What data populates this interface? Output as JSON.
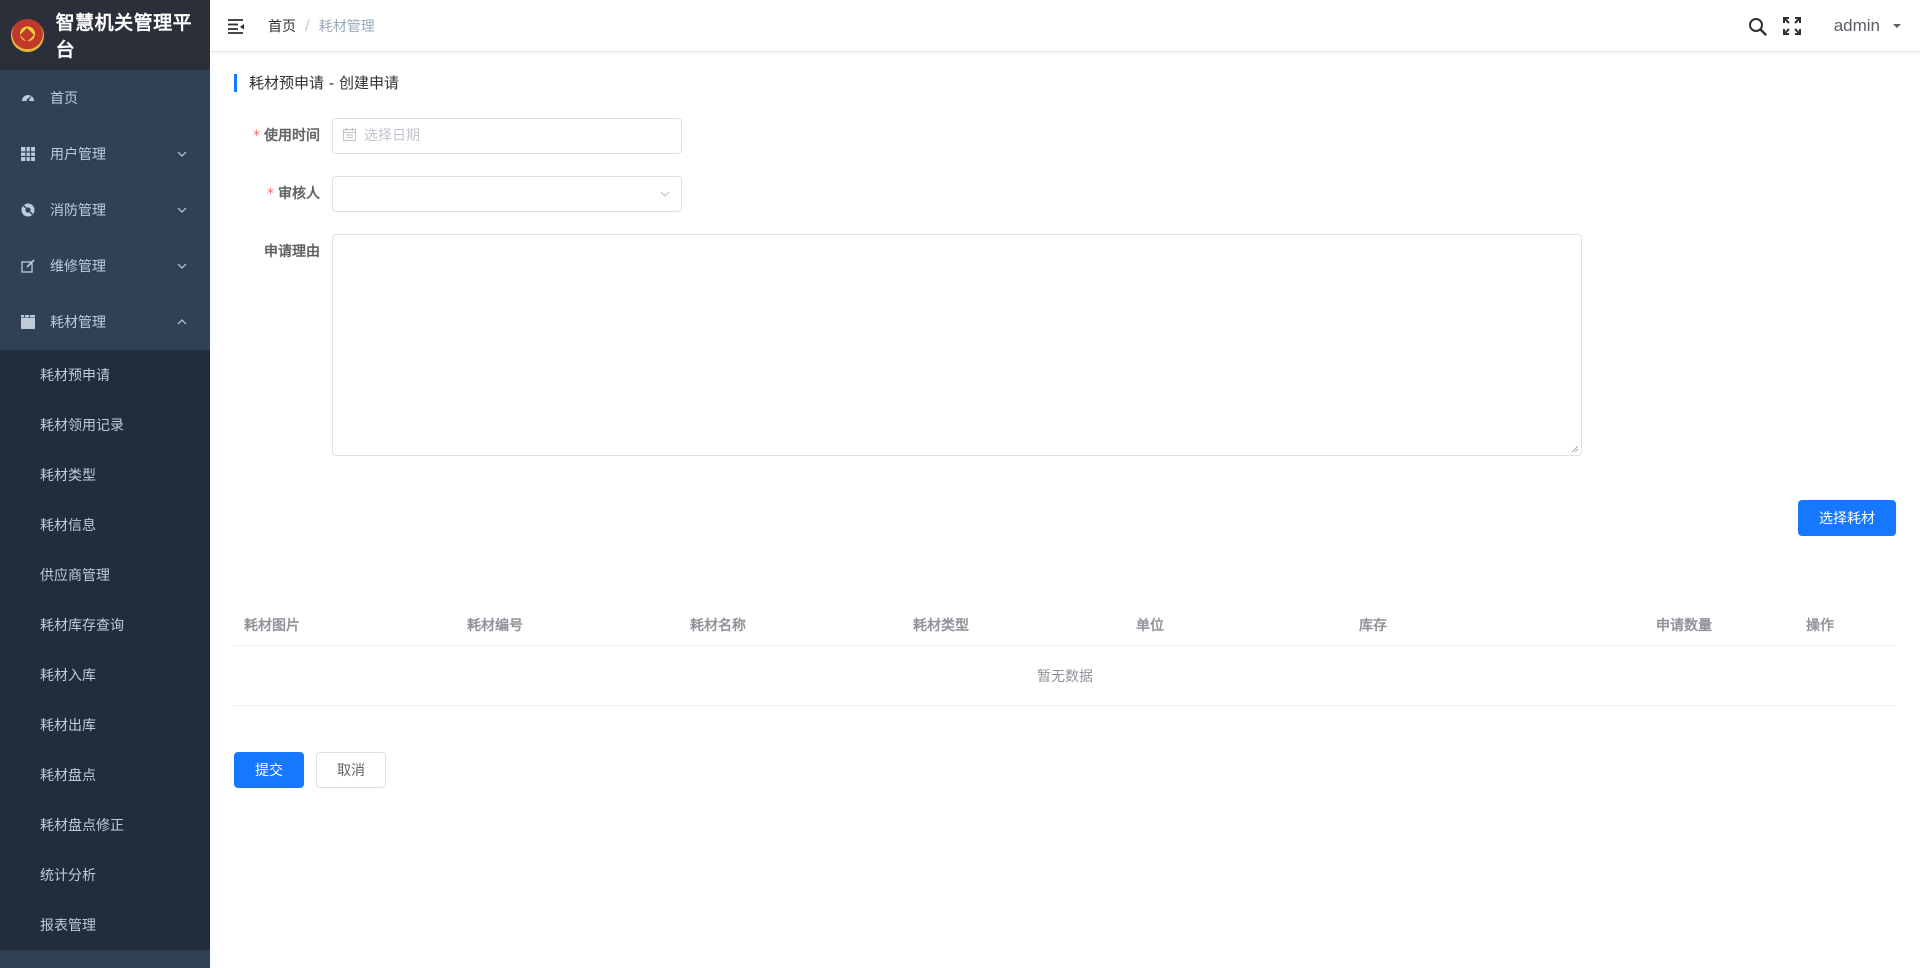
{
  "app": {
    "title": "智慧机关管理平台"
  },
  "sidebar": {
    "items": [
      {
        "label": "首页",
        "icon": "dashboard-icon",
        "expandable": false
      },
      {
        "label": "用户管理",
        "icon": "grid-icon",
        "expandable": true
      },
      {
        "label": "消防管理",
        "icon": "lifebuoy-icon",
        "expandable": true
      },
      {
        "label": "维修管理",
        "icon": "edit-icon",
        "expandable": true
      },
      {
        "label": "耗材管理",
        "icon": "clapper-icon",
        "expandable": true,
        "expanded": true
      }
    ],
    "subitems": [
      "耗材预申请",
      "耗材领用记录",
      "耗材类型",
      "耗材信息",
      "供应商管理",
      "耗材库存查询",
      "耗材入库",
      "耗材出库",
      "耗材盘点",
      "耗材盘点修正",
      "统计分析",
      "报表管理"
    ]
  },
  "header": {
    "breadcrumb": {
      "home": "首页",
      "separator": "/",
      "current": "耗材管理"
    },
    "user": "admin",
    "icons": [
      "menu-fold-icon",
      "search-icon",
      "fullscreen-icon",
      "caret-down-icon"
    ]
  },
  "page": {
    "title": "耗材预申请 - 创建申请",
    "form": {
      "use_time": {
        "label": "使用时间",
        "placeholder": "选择日期",
        "value": ""
      },
      "reviewer": {
        "label": "审核人",
        "value": ""
      },
      "reason": {
        "label": "申请理由",
        "value": ""
      }
    },
    "select_material_button": "选择耗材",
    "table": {
      "columns": [
        "耗材图片",
        "耗材编号",
        "耗材名称",
        "耗材类型",
        "单位",
        "库存",
        "申请数量",
        "操作"
      ],
      "empty_text": "暂无数据"
    },
    "submit_button": "提交",
    "cancel_button": "取消"
  },
  "colors": {
    "primary": "#1677ff",
    "sidebar_bg": "#304156",
    "submenu_bg": "#1f2d3d",
    "required": "#f56c6c"
  }
}
